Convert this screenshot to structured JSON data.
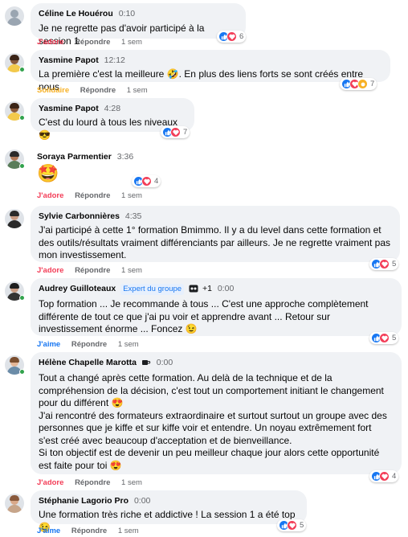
{
  "labels": {
    "adore": "J'adore",
    "solidaire": "Solidaire",
    "aime": "J'aime",
    "reply": "Répondre",
    "age": "1 sem"
  },
  "comments": [
    {
      "name": "Céline Le Houérou",
      "time": "0:10",
      "text": "Je ne regrette pas d'avoir participé à la session 1",
      "reaction": "J'adore",
      "count": "6",
      "avatar_color": "#cfd6de"
    },
    {
      "name": "Yasmine Papot",
      "time": "12:12",
      "text": "La première c'est la meilleure 🤣. En plus des liens forts se sont créés entre nous",
      "reaction": "Solidaire",
      "count": "7",
      "avatar_color": "#f3c94b"
    },
    {
      "name": "Yasmine Papot",
      "time": "4:28",
      "text": "C'est du lourd à tous les niveaux 😎",
      "reaction": "",
      "count": "7",
      "avatar_color": "#f3c94b"
    },
    {
      "name": "Soraya Parmentier",
      "time": "3:36",
      "text": "🤩",
      "reaction": "J'adore",
      "count": "4",
      "avatar_color": "#d8c4b0"
    },
    {
      "name": "Sylvie Carbonnières",
      "time": "4:35",
      "text": "J'ai participé à cette 1° formation Bmimmo. Il y a du level dans cette formation et des outils/résultats vraiment différenciants par ailleurs. Je ne regrette vraiment pas mon investissement.",
      "reaction": "J'adore",
      "count": "5",
      "avatar_color": "#cfd6de"
    },
    {
      "name": "Audrey Guilloteaux",
      "badge": "Expert du groupe",
      "extra": "+1",
      "time": "0:00",
      "text": "Top formation ... Je recommande à tous ... C'est une approche complètement différente de tout ce que j'ai pu voir et apprendre avant ... Retour sur investissement énorme ... Foncez 😉",
      "reaction": "J'aime",
      "count": "5",
      "avatar_color": "#cfd6de"
    },
    {
      "name": "Hélène Chapelle Marotta",
      "time": "0:00",
      "text": "Tout a changé après cette formation. Au delà de la technique et de la compréhension de la décision, c'est tout un comportement initiant le changement pour du différent 😍\nJ'ai rencontré des formateurs extraordinaire et surtout surtout un groupe avec des personnes que je kiffe et sur kiffe voir et entendre. Un noyau extrêmement fort s'est créé avec beaucoup d'acceptation et de bienveillance.\nSi ton objectif est de devenir un peu meilleur chaque jour alors cette opportunité est faite pour toi 😍",
      "reaction": "J'adore",
      "count": "4",
      "avatar_color": "#cfd6de"
    },
    {
      "name": "Stéphanie Lagorio Pro",
      "time": "0:00",
      "text": "Une formation très riche et addictive ! La session 1 a été top 😉",
      "reaction": "J'aime",
      "count": "5",
      "avatar_color": "#d8c4b0"
    }
  ]
}
